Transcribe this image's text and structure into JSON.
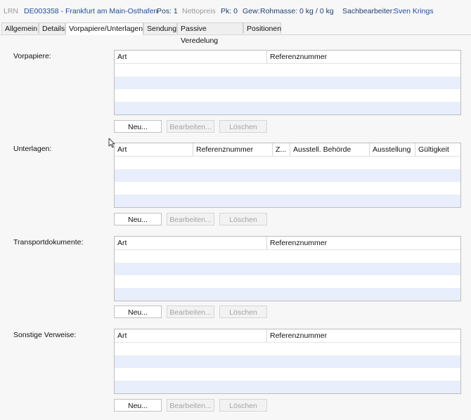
{
  "header": {
    "lrn_label": "LRN",
    "lrn_value": "DE003358 - Frankfurt am Main-Osthafen",
    "pos_text": "Pos: 1",
    "nettopreis_label": "Nettopreis",
    "pk_text": "Pk: 0",
    "gew_label": "Gew:",
    "rohmasse_text": "Rohmasse: 0 kg",
    "netto_text": "/ 0 kg",
    "sachbearbeiter_label": "Sachbearbeiter:",
    "sachbearbeiter_value": "Sven Krings"
  },
  "tabs": [
    {
      "label": "Allgemein"
    },
    {
      "label": "Details"
    },
    {
      "label": "Vorpapiere/Unterlagen",
      "active": true
    },
    {
      "label": "Sendung"
    },
    {
      "label": "Passive Veredelung"
    },
    {
      "label": "Positionen"
    }
  ],
  "sections": {
    "vorpapiere": {
      "label": "Vorpapiere:",
      "columns": [
        "Art",
        "Referenznummer"
      ]
    },
    "unterlagen": {
      "label": "Unterlagen:",
      "columns": [
        "Art",
        "Referenznummer",
        "Z...",
        "Ausstell. Behörde",
        "Ausstellung",
        "Gültigkeit"
      ]
    },
    "transportdokumente": {
      "label": "Transportdokumente:",
      "columns": [
        "Art",
        "Referenznummer"
      ]
    },
    "sonstige": {
      "label": "Sonstige Verweise:",
      "columns": [
        "Art",
        "Referenznummer"
      ]
    }
  },
  "buttons": {
    "new": "Neu...",
    "edit": "Bearbeiten...",
    "delete": "Löschen"
  },
  "colors": {
    "accent": "#1f4e9b",
    "row_alt": "#e8eefb"
  }
}
